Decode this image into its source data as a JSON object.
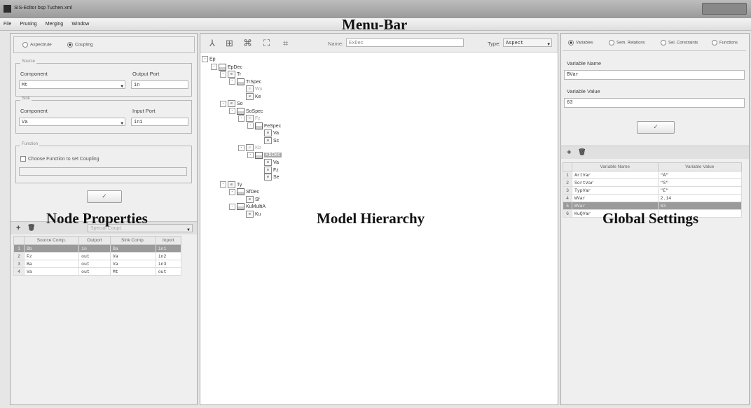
{
  "window": {
    "title": "SIS-Editor bsp Tuchen.xml"
  },
  "menu": [
    "File",
    "Pruning",
    "Merging",
    "Window"
  ],
  "labels": {
    "menu_bar": "Menu-Bar",
    "node_properties": "Node Properties",
    "model_hierarchy": "Model Hierarchy",
    "global_settings": "Global Settings"
  },
  "left": {
    "mode": {
      "options": [
        "Aspectrule",
        "Coupling"
      ],
      "selected": "Coupling"
    },
    "source": {
      "legend": "Source",
      "component_label": "Component",
      "component_value": "Mt",
      "port_label": "Output Port",
      "port_value": "in"
    },
    "sink": {
      "legend": "Sink",
      "component_label": "Component",
      "component_value": "Va",
      "port_label": "Input Port",
      "port_value": "in1"
    },
    "function": {
      "legend": "Function",
      "checkbox_label": "Choose Function to set Coupling",
      "field_value": ""
    },
    "apply_label": "✓",
    "coupling_table": {
      "headers": [
        "Source Comp.",
        "Outport",
        "Sink Comp.",
        "Inport"
      ],
      "rows": [
        [
          "Bb",
          "in",
          "Ba",
          "in1"
        ],
        [
          "Fz",
          "out",
          "Va",
          "in2"
        ],
        [
          "Ba",
          "out",
          "Va",
          "in3"
        ],
        [
          "Va",
          "out",
          "Mt",
          "out"
        ]
      ],
      "selected_row": 0
    },
    "coupling_combo": "Special Coupl."
  },
  "center": {
    "name_label": "Name:",
    "name_value": "ExDec",
    "type_label": "Type:",
    "type_value": "Aspect",
    "tree": [
      {
        "d": 0,
        "t": "",
        "label": "Ep",
        "tog": "⊟"
      },
      {
        "d": 1,
        "t": "grp",
        "label": "EpDec",
        "tog": "⊟"
      },
      {
        "d": 2,
        "t": "e",
        "label": "Tr",
        "tog": "⊟"
      },
      {
        "d": 3,
        "t": "grp",
        "label": "TrSpec",
        "tog": "⊟"
      },
      {
        "d": 4,
        "t": "e",
        "label": "Wu",
        "tog": "",
        "dim": true
      },
      {
        "d": 4,
        "t": "e",
        "label": "Ke",
        "tog": ""
      },
      {
        "d": 2,
        "t": "e",
        "label": "So",
        "tog": "⊟"
      },
      {
        "d": 3,
        "t": "grp",
        "label": "SoSpec",
        "tog": "⊟"
      },
      {
        "d": 4,
        "t": "e",
        "label": "Fz",
        "tog": "⊟",
        "dim": true
      },
      {
        "d": 5,
        "t": "grp",
        "label": "FeSpec",
        "tog": "⊟"
      },
      {
        "d": 6,
        "t": "e",
        "label": "Va",
        "tog": ""
      },
      {
        "d": 6,
        "t": "e",
        "label": "Sc",
        "tog": ""
      },
      {
        "d": 4,
        "t": "e",
        "label": "Kb",
        "tog": "⊟",
        "dim": true
      },
      {
        "d": 5,
        "t": "grp",
        "label": "KbDec",
        "tog": "⊟",
        "sel": true
      },
      {
        "d": 6,
        "t": "e",
        "label": "Va",
        "tog": ""
      },
      {
        "d": 6,
        "t": "e",
        "label": "Fz",
        "tog": ""
      },
      {
        "d": 6,
        "t": "e",
        "label": "Se",
        "tog": ""
      },
      {
        "d": 2,
        "t": "e",
        "label": "Ty",
        "tog": "⊟"
      },
      {
        "d": 3,
        "t": "grp",
        "label": "SfDec",
        "tog": "⊟"
      },
      {
        "d": 4,
        "t": "e",
        "label": "Sf",
        "tog": ""
      },
      {
        "d": 3,
        "t": "grp",
        "label": "KuMultiA",
        "tog": "⊟"
      },
      {
        "d": 4,
        "t": "e",
        "label": "Ku",
        "tog": ""
      }
    ]
  },
  "right": {
    "tabs": [
      "Variables",
      "Sem. Relations",
      "Sel. Constraints",
      "Functions"
    ],
    "selected_tab": "Variables",
    "var_name_label": "Variable Name",
    "var_name_value": "BVar",
    "var_value_label": "Variable Value",
    "var_value_value": "63",
    "apply_label": "✓",
    "var_table": {
      "headers": [
        "Variable Name",
        "Variable Value"
      ],
      "rows": [
        [
          "ArtVar",
          "\"A\""
        ],
        [
          "SortVar",
          "\"S\""
        ],
        [
          "TypVar",
          "\"E\""
        ],
        [
          "WVar",
          "2.14"
        ],
        [
          "BVar",
          "63"
        ],
        [
          "KuQVar",
          ""
        ]
      ],
      "selected_row": 4
    }
  }
}
